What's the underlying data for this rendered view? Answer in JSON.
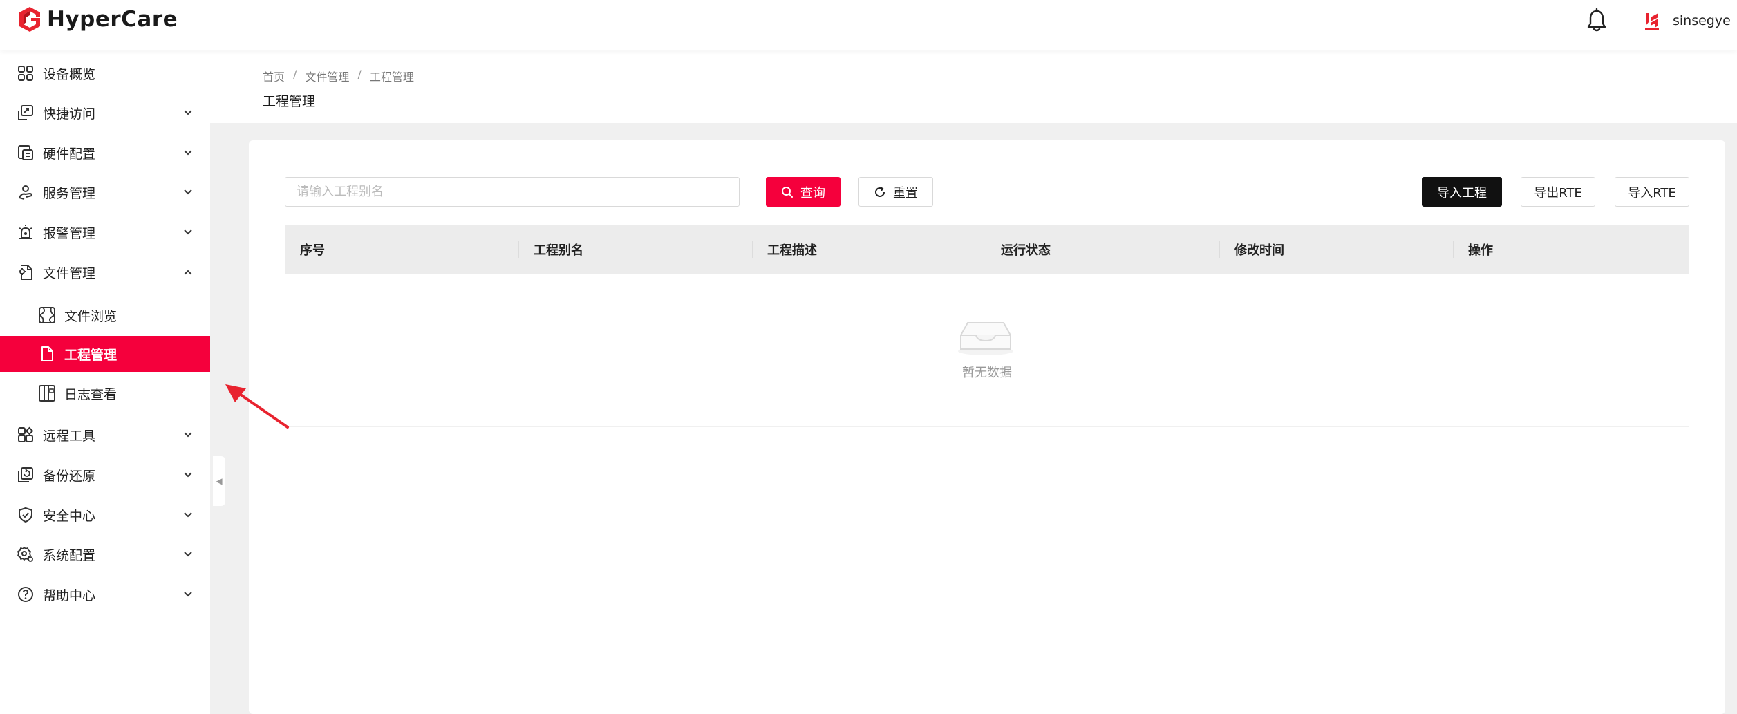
{
  "app": {
    "logo_text": "HyperCare"
  },
  "header": {
    "username": "sinsegye",
    "user_caret": "⌄"
  },
  "sidebar": {
    "items": [
      {
        "label": "设备概览",
        "icon": "grid-icon"
      },
      {
        "label": "快捷访问",
        "icon": "shortcut-icon"
      },
      {
        "label": "硬件配置",
        "icon": "hardware-icon"
      },
      {
        "label": "服务管理",
        "icon": "service-icon"
      },
      {
        "label": "报警管理",
        "icon": "alarm-icon"
      },
      {
        "label": "文件管理",
        "icon": "file-manage-icon"
      },
      {
        "label": "远程工具",
        "icon": "remote-icon"
      },
      {
        "label": "备份还原",
        "icon": "backup-icon"
      },
      {
        "label": "安全中心",
        "icon": "shield-icon"
      },
      {
        "label": "系统配置",
        "icon": "gear-icon"
      },
      {
        "label": "帮助中心",
        "icon": "help-icon"
      }
    ],
    "sub_items": [
      {
        "label": "文件浏览",
        "icon": "browse-icon"
      },
      {
        "label": "工程管理",
        "icon": "document-icon"
      },
      {
        "label": "日志查看",
        "icon": "log-icon"
      }
    ],
    "collapse_glyph": "◀"
  },
  "breadcrumb": {
    "items": [
      "首页",
      "文件管理",
      "工程管理"
    ],
    "separator": "/"
  },
  "page": {
    "title": "工程管理"
  },
  "toolbar": {
    "search_placeholder": "请输入工程别名",
    "query_label": "查询",
    "reset_label": "重置",
    "import_project_label": "导入工程",
    "export_rte_label": "导出RTE",
    "import_rte_label": "导入RTE"
  },
  "table": {
    "columns": [
      "序号",
      "工程别名",
      "工程描述",
      "运行状态",
      "修改时间",
      "操作"
    ],
    "rows": [],
    "empty_text": "暂无数据"
  },
  "colors": {
    "accent": "#f5003c",
    "dark_button": "#111111",
    "annotation_arrow": "#e8232f"
  }
}
